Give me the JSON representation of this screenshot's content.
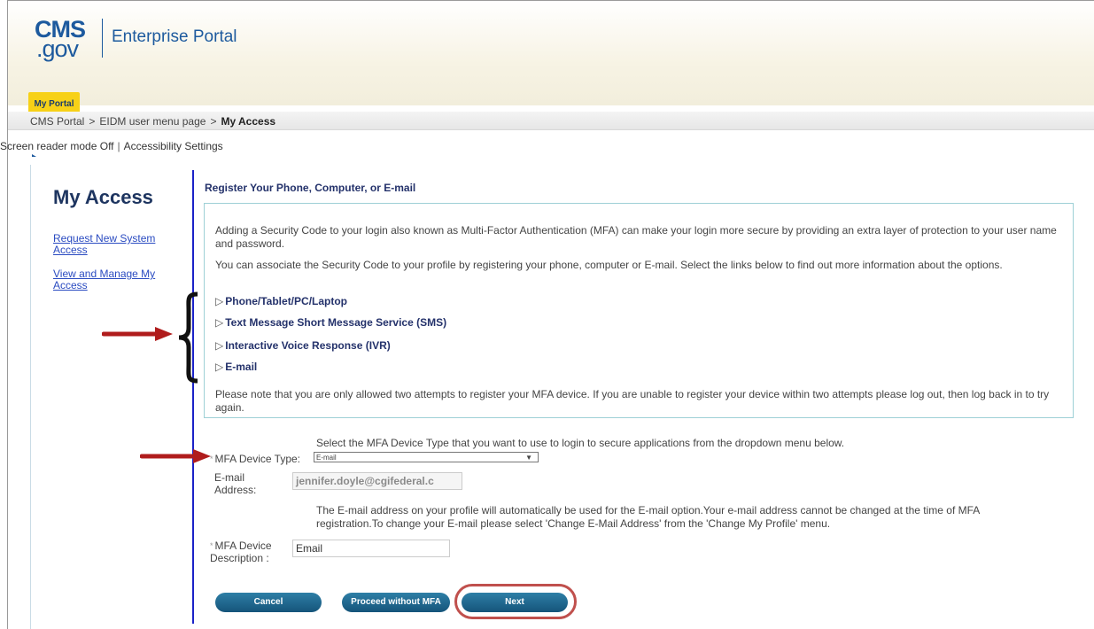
{
  "header": {
    "logo_cms": "CMS",
    "logo_gov": ".gov",
    "portal_title": "Enterprise Portal",
    "my_portal_label": "My Portal"
  },
  "breadcrumb": {
    "items": [
      "CMS Portal",
      "EIDM user menu page",
      "My Access"
    ],
    "separator": ">"
  },
  "accessibility": {
    "screen_reader": "Screen reader mode Off",
    "separator": "|",
    "settings": "Accessibility Settings"
  },
  "sidebar": {
    "title": "My Access",
    "links": [
      {
        "line1": "Request New System",
        "line2": "Access"
      },
      {
        "line1": "View and Manage My",
        "line2": "Access"
      }
    ]
  },
  "main": {
    "section_title": "Register Your Phone, Computer, or E-mail",
    "intro_1": "Adding a Security Code to your login also known as Multi-Factor Authentication (MFA) can make your login more secure by providing an extra layer of protection to your user name and password.",
    "intro_2": "You can associate the Security Code to your profile by registering your phone, computer or E-mail. Select the links below to find out more information about the options.",
    "options": [
      "Phone/Tablet/PC/Laptop",
      "Text Message Short Message Service (SMS)",
      "Interactive Voice Response (IVR)",
      "E-mail"
    ],
    "option_marker": "▷",
    "warning": "Please note that you are only allowed two attempts to register your MFA device. If you are unable to register your device within two attempts please log out, then log back in to try again."
  },
  "form": {
    "instruction": "Select the MFA Device Type that you want to use to login to secure applications from the dropdown menu below.",
    "required_marker": "*",
    "device_type_label": "MFA Device Type:",
    "device_type_value": "E-mail",
    "email_label_1": "E-mail",
    "email_label_2": "Address:",
    "email_value": "jennifer.doyle@cgifederal.c",
    "email_note": "The E-mail address on your profile will automatically be used for the E-mail option.Your e-mail address cannot be changed at the time of MFA registration.To change your E-mail please select 'Change E-Mail Address' from the 'Change My Profile' menu.",
    "description_label_1": "MFA Device",
    "description_label_2": "Description :",
    "description_value": "Email"
  },
  "buttons": {
    "cancel": "Cancel",
    "proceed": "Proceed without MFA",
    "next": "Next"
  },
  "colors": {
    "annotation_arrow": "#b01c1c",
    "highlight_ring": "#c0504d",
    "rule": "#1b22c8"
  }
}
